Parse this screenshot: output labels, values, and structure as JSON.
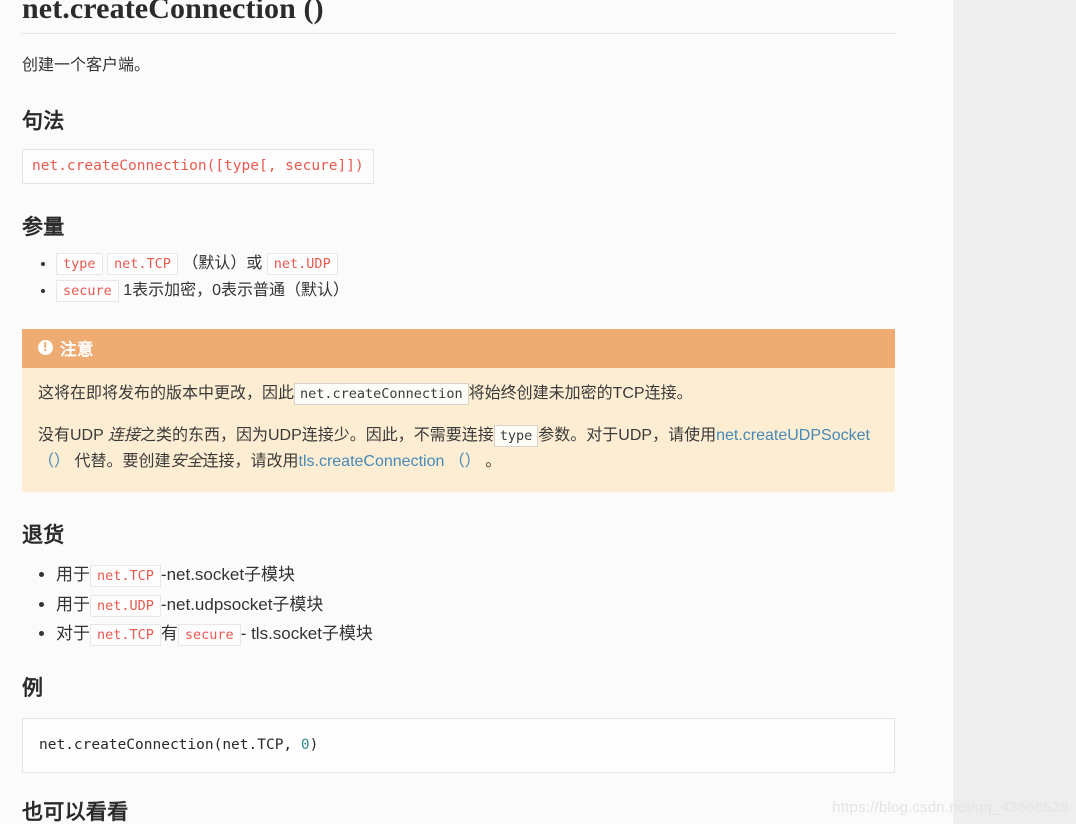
{
  "page": {
    "title": "net.createConnection ()",
    "intro": "创建一个客户端。"
  },
  "sections": {
    "syntax": {
      "heading": "句法",
      "code": "net.createConnection([type[, secure]])"
    },
    "parameters": {
      "heading": "参量",
      "items": [
        {
          "chip1": "type",
          "chip2": "net.TCP",
          "mid": "（默认）或",
          "chip3": "net.UDP"
        },
        {
          "chip1": "secure",
          "text": "1表示加密，0表示普通（默认）"
        }
      ]
    },
    "note": {
      "header_label": "注意",
      "icon": "exclamation-circle-icon",
      "p1_before": "这将在即将发布的版本中更改，因此",
      "p1_chip": "net.createConnection",
      "p1_after": "将始终创建未加密的TCP连接。",
      "p2_a": "没有UDP ",
      "p2_em": "连接",
      "p2_b": "之类的东西，因为UDP连接少。因此，不需要连接",
      "p2_chip": "type",
      "p2_c": "参数。对于UDP，请使用",
      "p2_link1": "net.createUDPSocket （）",
      "p2_d": " 代替。要创建",
      "p2_em2": "安全",
      "p2_e": "连接，请改用",
      "p2_link2": "tls.createConnection （）",
      "p2_f": " 。"
    },
    "returns": {
      "heading": "退货",
      "items": [
        {
          "pre": "用于",
          "chip": "net.TCP",
          "post": "-net.socket子模块"
        },
        {
          "pre": "用于",
          "chip": "net.UDP",
          "post": "-net.udpsocket子模块"
        },
        {
          "pre": "对于",
          "chip": "net.TCP",
          "mid": "有",
          "chip2": "secure",
          "post": "- tls.socket子模块"
        }
      ]
    },
    "example": {
      "heading": "例",
      "code_fn": "net.createConnection(net.TCP, ",
      "code_num": "0",
      "code_tail": ")"
    },
    "see_also": {
      "heading": "也可以看看"
    }
  },
  "watermark": {
    "text": "https://blog.csdn.net/qq_43666528"
  },
  "colors": {
    "code_red": "#e8594f",
    "note_header_bg": "#eeac72",
    "note_body_bg": "#fdedd2",
    "link_blue": "#4689b8",
    "page_bg": "#fbfbfb",
    "gutter_bg": "#eeeeee"
  }
}
